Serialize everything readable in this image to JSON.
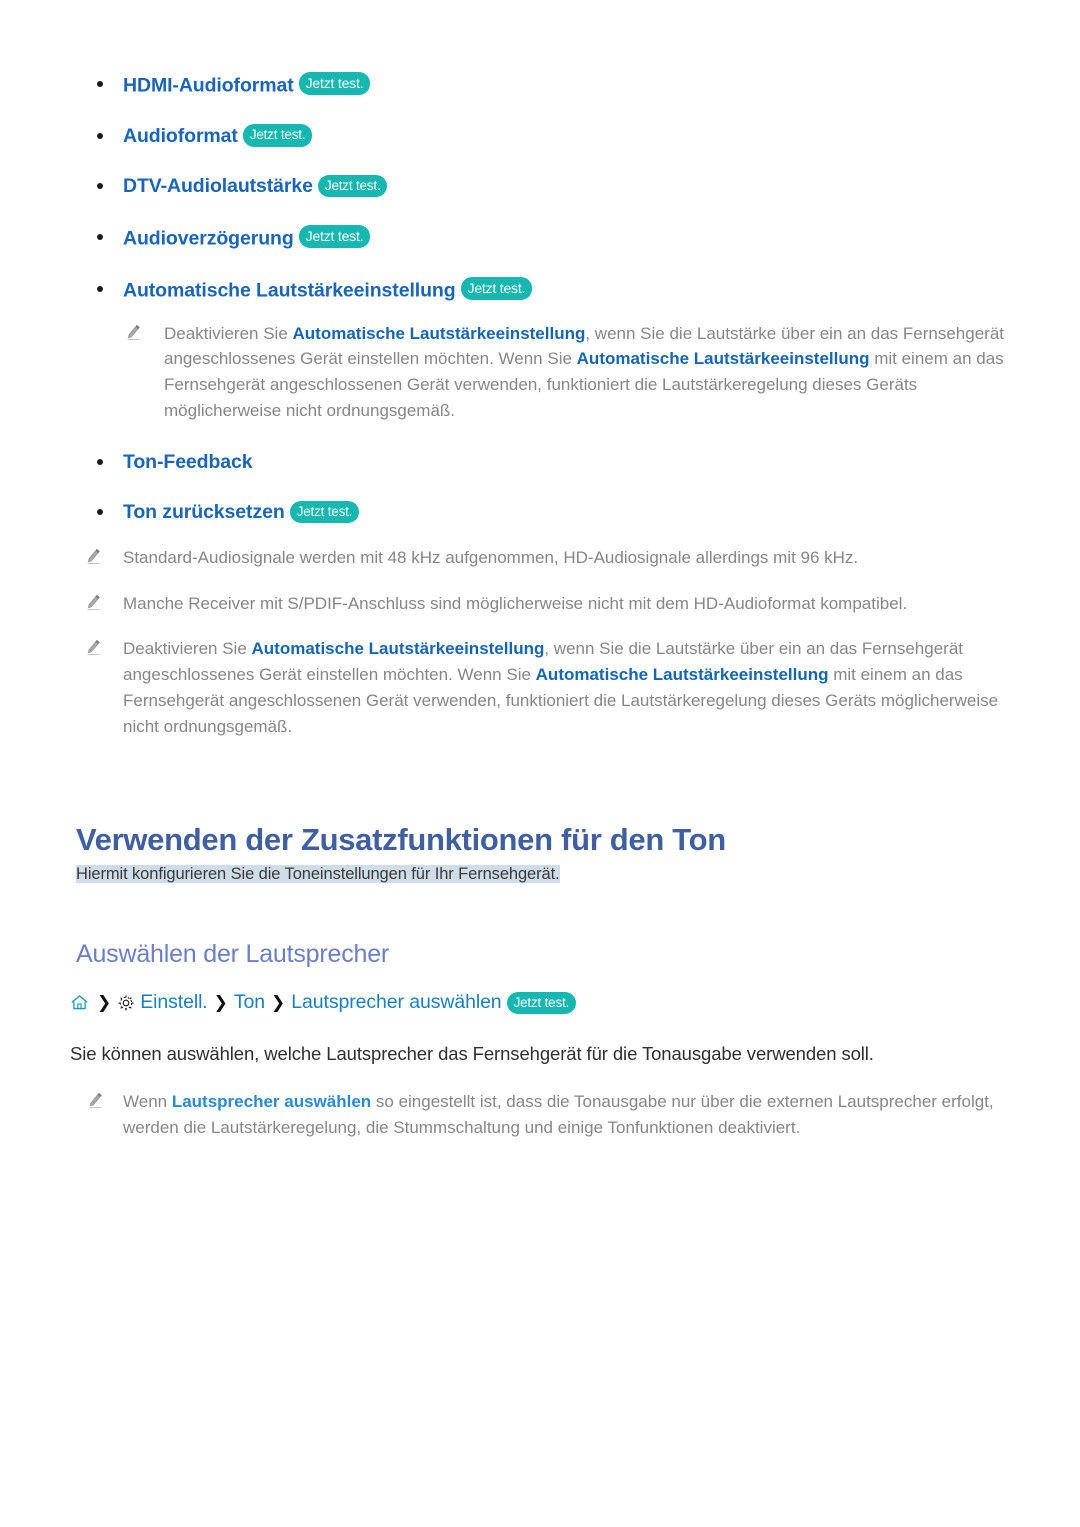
{
  "badge": {
    "label": "Jetzt test."
  },
  "icons": {
    "note": "pencil-icon",
    "home": "home-icon",
    "settings": "gear-icon",
    "separator": "chevron-right-icon"
  },
  "colors": {
    "link_blue": "#1a65b5",
    "link_bold_blue": "#1565b0",
    "badge_teal": "#16b7b0",
    "heading_navy": "#3f5fa0",
    "subheading_periwinkle": "#6b7fc6",
    "note_gray": "#868686",
    "highlight_blue": "#cfdde9"
  },
  "settings_list": [
    {
      "label": "HDMI-Audioformat",
      "has_badge": true
    },
    {
      "label": "Audioformat",
      "has_badge": true
    },
    {
      "label": "DTV-Audiolautstärke",
      "has_badge": true
    },
    {
      "label": "Audioverzögerung",
      "has_badge": true
    },
    {
      "label": "Automatische Lautstärkeeinstellung",
      "has_badge": true
    },
    {
      "label": "Ton-Feedback",
      "has_badge": false
    },
    {
      "label": "Ton zurücksetzen",
      "has_badge": true
    }
  ],
  "nested_note": {
    "p1": "Deaktivieren Sie ",
    "link1": "Automatische Lautstärkeeinstellung",
    "p2": ", wenn Sie die Lautstärke über ein an das Fernsehgerät angeschlossenes Gerät einstellen möchten. Wenn Sie ",
    "link2": "Automatische Lautstärkeeinstellung",
    "p3": " mit einem an das Fernsehgerät angeschlossenen Gerät verwenden, funktioniert die Lautstärkeregelung dieses Geräts möglicherweise nicht ordnungsgemäß."
  },
  "notes": [
    {
      "text": "Standard-Audiosignale werden mit 48 kHz aufgenommen, HD-Audiosignale allerdings mit 96 kHz."
    },
    {
      "text": "Manche Receiver mit S/PDIF-Anschluss sind möglicherweise nicht mit dem HD-Audioformat kompatibel."
    }
  ],
  "note_long": {
    "p1": "Deaktivieren Sie ",
    "link1": "Automatische Lautstärkeeinstellung",
    "p2": ", wenn Sie die Lautstärke über ein an das Fernsehgerät angeschlossenes Gerät einstellen möchten. Wenn Sie ",
    "link2": "Automatische Lautstärkeeinstellung",
    "p3": " mit einem an das Fernsehgerät angeschlossenen Gerät verwenden, funktioniert die Lautstärkeregelung dieses Geräts möglicherweise nicht ordnungsgemäß."
  },
  "section": {
    "title": "Verwenden der Zusatzfunktionen für den Ton",
    "subtitle": "Hiermit konfigurieren Sie die Toneinstellungen für Ihr Fernsehgerät.",
    "heading2": "Auswählen der Lautsprecher"
  },
  "breadcrumb": {
    "items": [
      {
        "label": "Einstell.",
        "icon": "gear-icon"
      },
      {
        "label": "Ton",
        "icon": null
      },
      {
        "label": "Lautsprecher auswählen",
        "icon": null
      }
    ],
    "separator": "❯",
    "badge": "Jetzt test."
  },
  "body": {
    "paragraph": "Sie können auswählen, welche Lautsprecher das Fernsehgerät für die Tonausgabe verwenden soll."
  },
  "final_note": {
    "p1": "Wenn ",
    "link1": "Lautsprecher auswählen",
    "p2": " so eingestellt ist, dass die Tonausgabe nur über die externen Lautsprecher erfolgt, werden die Lautstärkeregelung, die Stummschaltung und einige Tonfunktionen deaktiviert."
  }
}
